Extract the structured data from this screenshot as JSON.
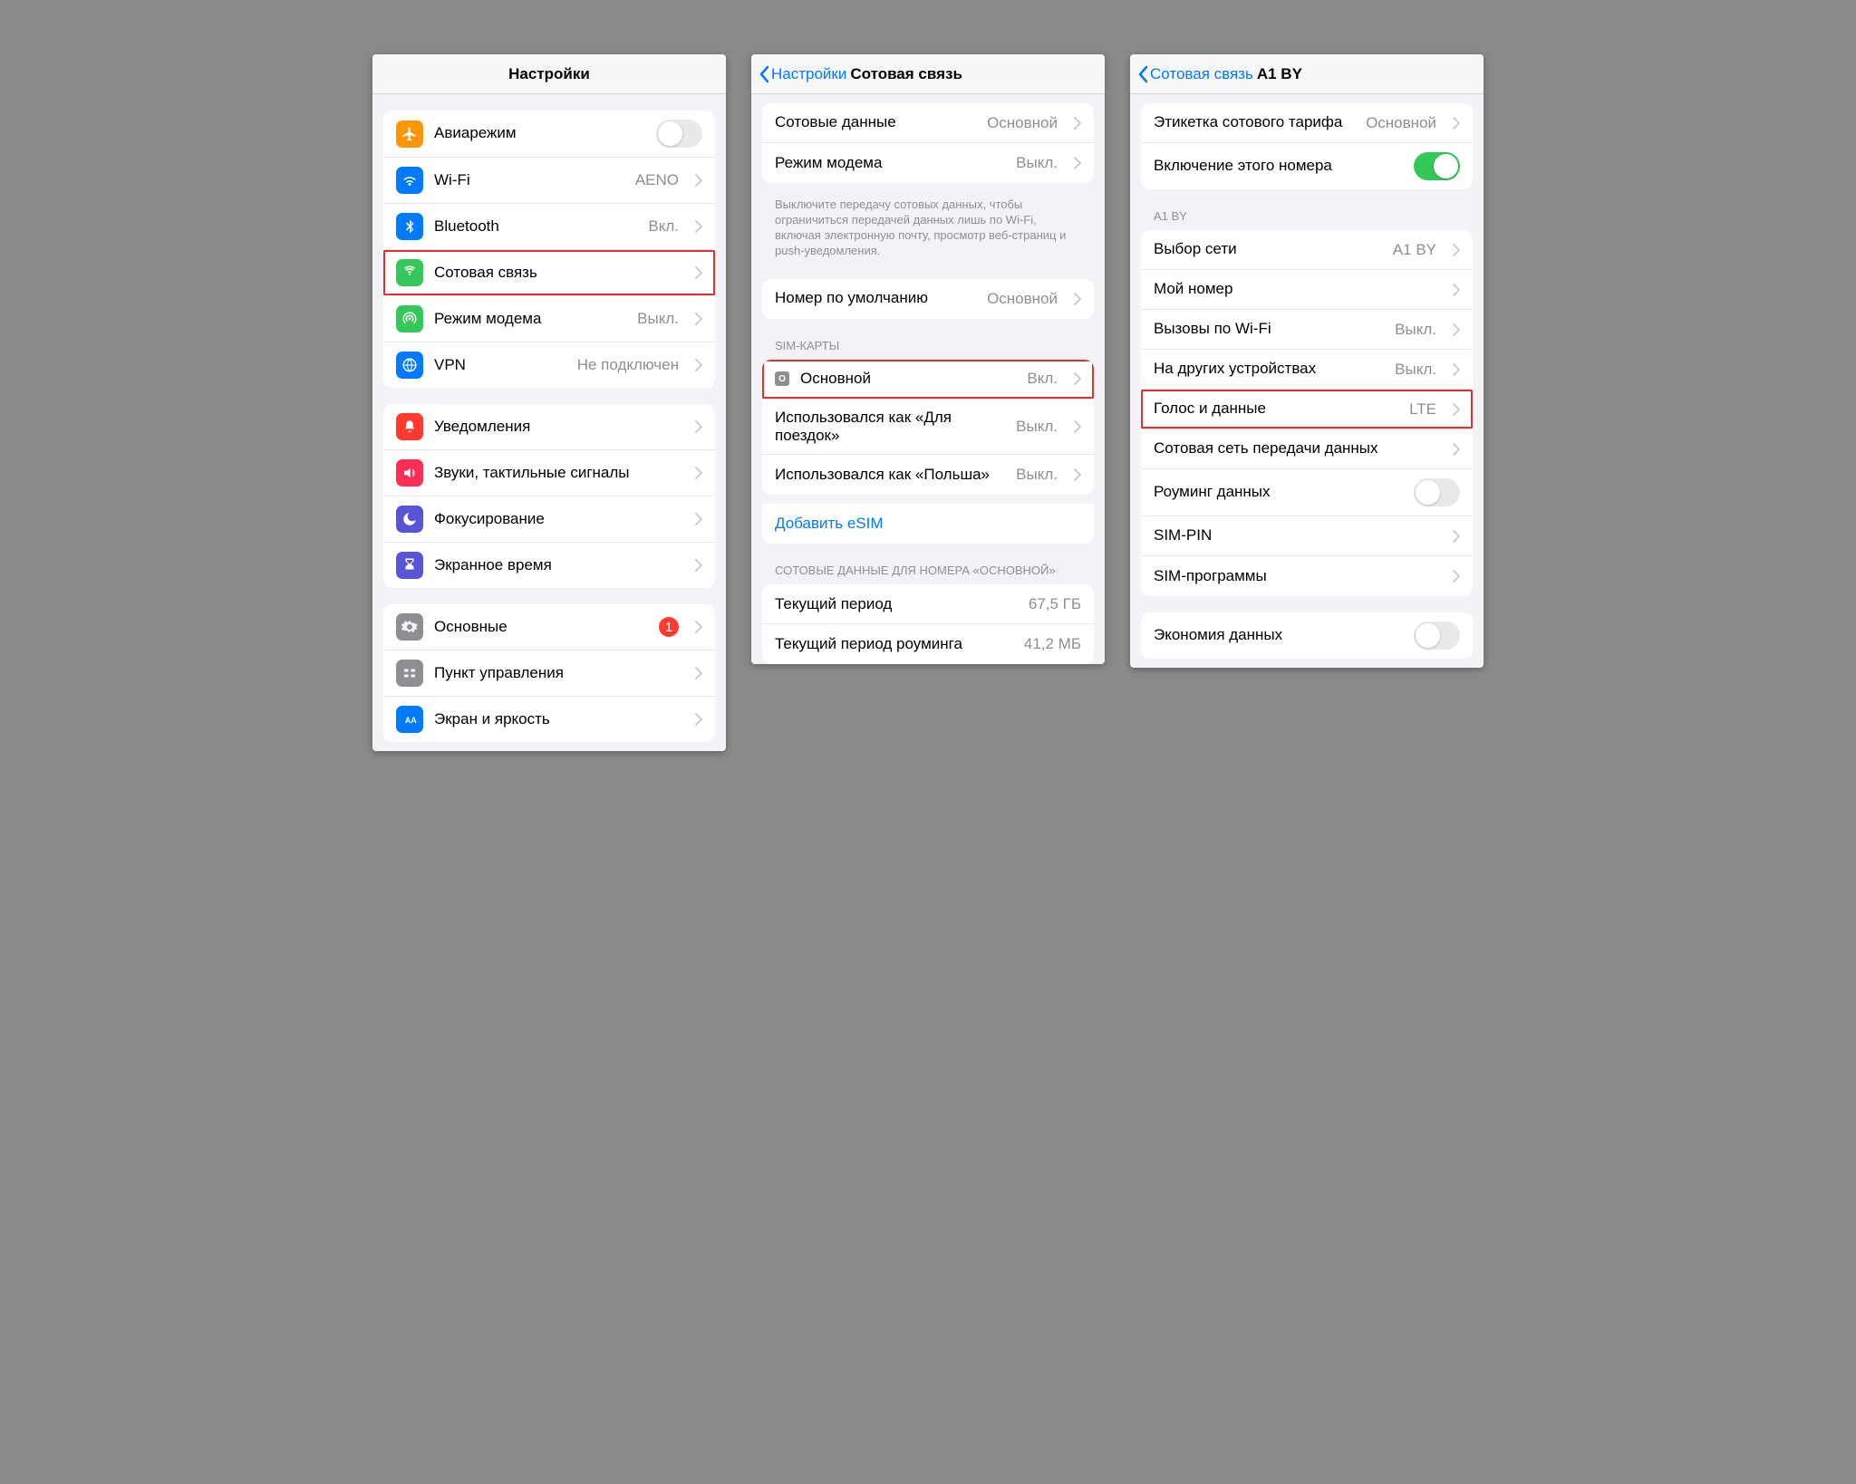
{
  "screen1": {
    "title": "Настройки",
    "rows": [
      {
        "label": "Авиарежим",
        "value": "",
        "toggle": false,
        "toggleOn": false,
        "icon": "airplane",
        "iconBg": "#ff9500"
      },
      {
        "label": "Wi-Fi",
        "value": "AENO",
        "icon": "wifi",
        "iconBg": "#007aff"
      },
      {
        "label": "Bluetooth",
        "value": "Вкл.",
        "icon": "bluetooth",
        "iconBg": "#007aff"
      },
      {
        "label": "Сотовая связь",
        "value": "",
        "icon": "cellular",
        "iconBg": "#34c759",
        "highlight": true
      },
      {
        "label": "Режим модема",
        "value": "Выкл.",
        "icon": "hotspot",
        "iconBg": "#34c759"
      },
      {
        "label": "VPN",
        "value": "Не подключен",
        "icon": "vpn",
        "iconBg": "#007aff"
      }
    ],
    "rows2": [
      {
        "label": "Уведомления",
        "icon": "bell",
        "iconBg": "#ff3b30"
      },
      {
        "label": "Звуки, тактильные сигналы",
        "icon": "sound",
        "iconBg": "#ff2d55"
      },
      {
        "label": "Фокусирование",
        "icon": "moon",
        "iconBg": "#5856d6"
      },
      {
        "label": "Экранное время",
        "icon": "hourglass",
        "iconBg": "#5856d6"
      }
    ],
    "rows3": [
      {
        "label": "Основные",
        "badge": "1",
        "icon": "gear",
        "iconBg": "#8e8e93"
      },
      {
        "label": "Пункт управления",
        "icon": "control",
        "iconBg": "#8e8e93"
      },
      {
        "label": "Экран и яркость",
        "icon": "brightness",
        "iconBg": "#007aff"
      }
    ]
  },
  "screen2": {
    "back": "Настройки",
    "title": "Сотовая связь",
    "rows": [
      {
        "label": "Сотовые данные",
        "value": "Основной"
      },
      {
        "label": "Режим модема",
        "value": "Выкл."
      }
    ],
    "note": "Выключите передачу сотовых данных, чтобы ограничиться передачей данных лишь по Wi-Fi, включая электронную почту, просмотр веб-страниц и push-уведомления.",
    "rows2": [
      {
        "label": "Номер по умолчанию",
        "value": "Основной"
      }
    ],
    "simHeader": "SIM-КАРТЫ",
    "sims": [
      {
        "label": "Основной",
        "value": "Вкл.",
        "highlight": true,
        "badge": "O"
      },
      {
        "label": "Использовался как «Для поездок»",
        "value": "Выкл."
      },
      {
        "label": "Использовался как «Польша»",
        "value": "Выкл."
      }
    ],
    "addEsim": "Добавить eSIM",
    "usageHeader": "СОТОВЫЕ ДАННЫЕ ДЛЯ НОМЕРА «ОСНОВНОЙ»",
    "usage": [
      {
        "label": "Текущий период",
        "value": "67,5 ГБ"
      },
      {
        "label": "Текущий период роуминга",
        "value": "41,2 МБ"
      }
    ]
  },
  "screen3": {
    "back": "Сотовая связь",
    "title": "A1 BY",
    "rows": [
      {
        "label": "Этикетка сотового тарифа",
        "value": "Основной",
        "chev": true
      },
      {
        "label": "Включение этого номера",
        "toggle": true,
        "toggleOn": true
      }
    ],
    "carrierHeader": "A1 BY",
    "rows2": [
      {
        "label": "Выбор сети",
        "value": "A1 BY"
      },
      {
        "label": "Мой номер",
        "value": ""
      },
      {
        "label": "Вызовы по Wi-Fi",
        "value": "Выкл."
      },
      {
        "label": "На других устройствах",
        "value": "Выкл."
      },
      {
        "label": "Голос и данные",
        "value": "LTE",
        "highlight": true
      },
      {
        "label": "Сотовая сеть передачи данных",
        "value": ""
      },
      {
        "label": "Роуминг данных",
        "toggle": true,
        "toggleOn": false
      },
      {
        "label": "SIM-PIN",
        "value": ""
      },
      {
        "label": "SIM-программы",
        "value": ""
      }
    ],
    "rows3": [
      {
        "label": "Экономия данных",
        "toggle": true,
        "toggleOn": false
      }
    ]
  }
}
